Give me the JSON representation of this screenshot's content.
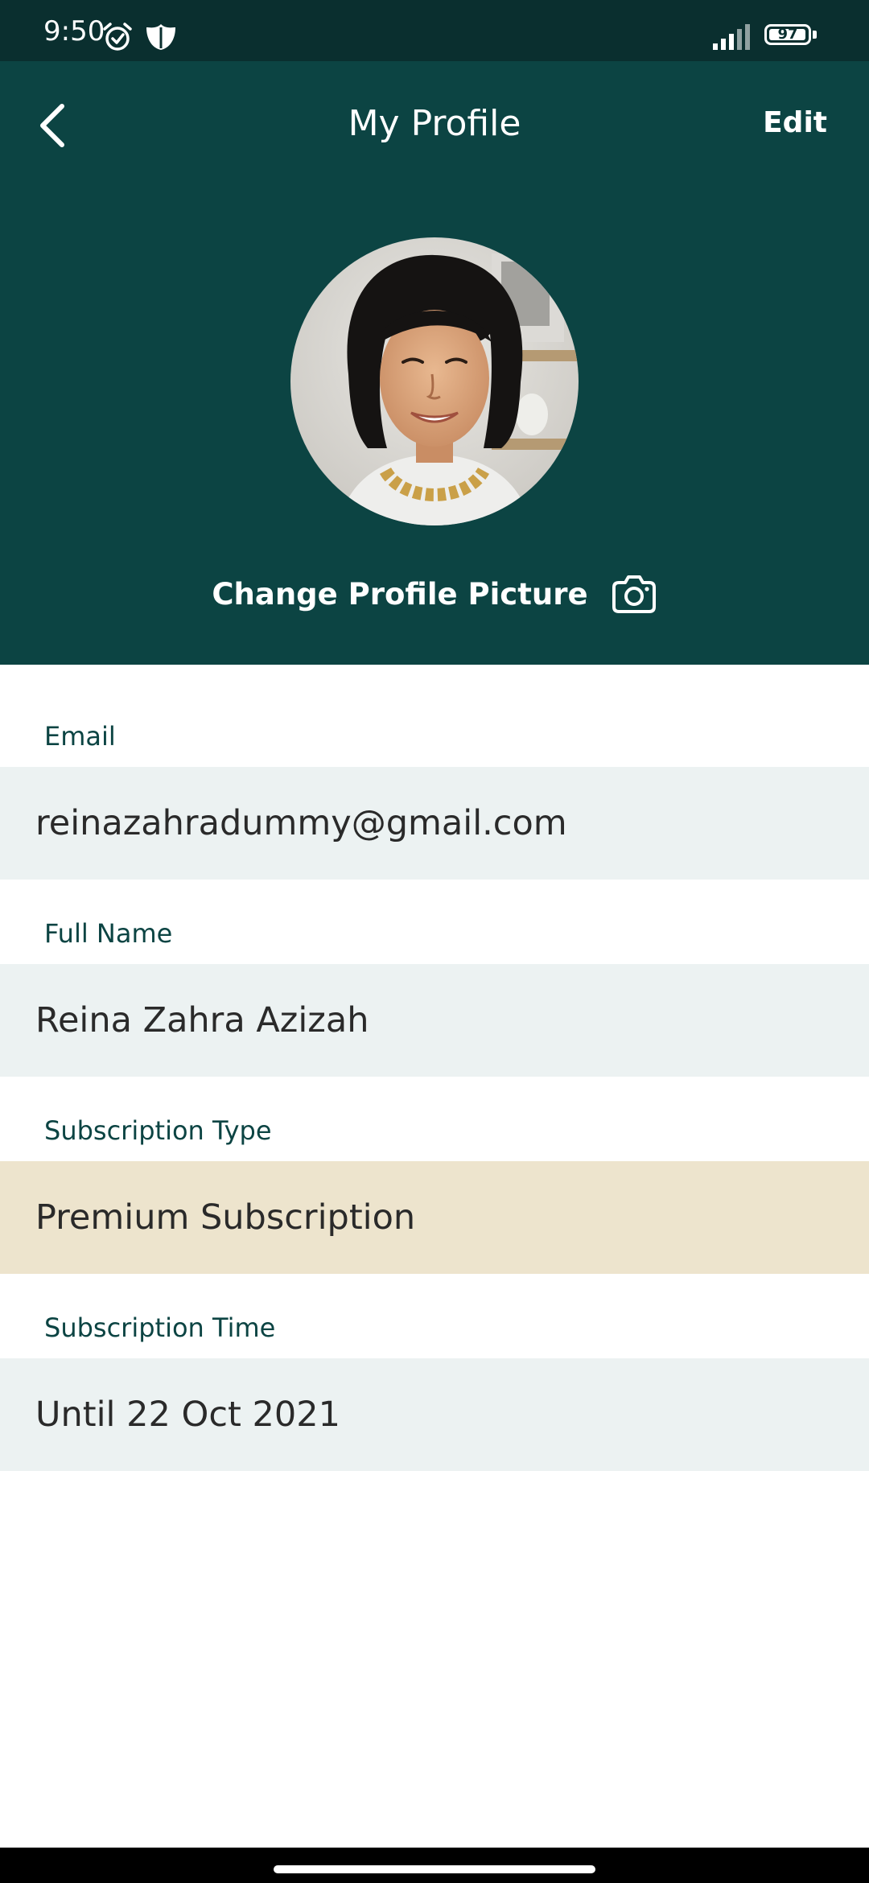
{
  "status_bar": {
    "time": "9:50",
    "battery_level": "97",
    "battery_fraction": 0.97
  },
  "header": {
    "title": "My Profile",
    "edit_label": "Edit",
    "change_picture_label": "Change Profile Picture",
    "back_icon": "chevron-left-icon",
    "camera_icon": "camera-icon"
  },
  "fields": {
    "email": {
      "label": "Email",
      "value": "reinazahradummy@gmail.com"
    },
    "full_name": {
      "label": "Full Name",
      "value": "Reina Zahra Azizah"
    },
    "subscription_type": {
      "label": "Subscription Type",
      "value": "Premium Subscription"
    },
    "subscription_time": {
      "label": "Subscription Time",
      "value": "Until 22 Oct 2021"
    }
  },
  "colors": {
    "header_bg": "#0c4443",
    "status_bg": "#0a2f2f",
    "field_bg": "#ecf2f2",
    "premium_bg": "#ede4cd",
    "label_color": "#0c4443"
  }
}
